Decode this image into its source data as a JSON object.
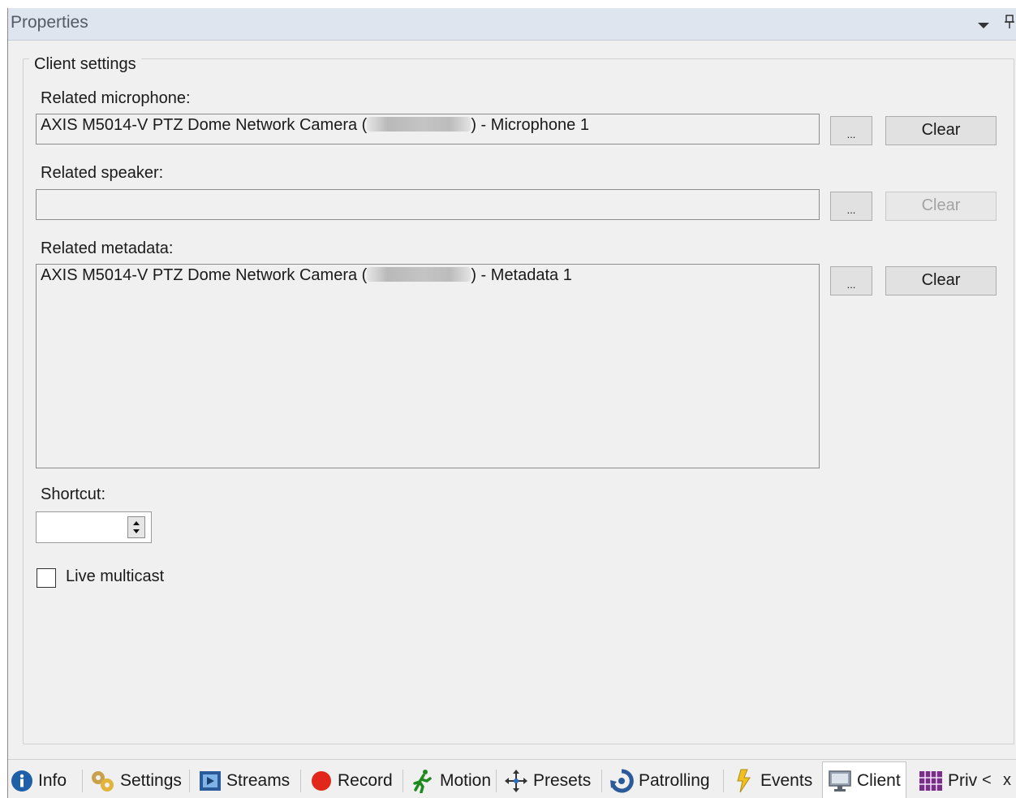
{
  "window": {
    "title": "Properties"
  },
  "group": {
    "title": "Client settings"
  },
  "microphone": {
    "label": "Related microphone:",
    "value_prefix": "AXIS M5014-V PTZ Dome Network Camera (",
    "value_suffix": ") - Microphone 1",
    "browse": "...",
    "clear": "Clear"
  },
  "speaker": {
    "label": "Related speaker:",
    "value": "",
    "browse": "...",
    "clear": "Clear",
    "clear_enabled": false
  },
  "metadata": {
    "label": "Related metadata:",
    "value_prefix": "AXIS M5014-V PTZ Dome Network Camera (",
    "value_suffix": ") - Metadata 1",
    "browse": "...",
    "clear": "Clear"
  },
  "shortcut": {
    "label": "Shortcut:",
    "value": ""
  },
  "live_multicast": {
    "label": "Live multicast",
    "checked": false
  },
  "tabs": [
    {
      "label": "Info",
      "icon": "info-icon"
    },
    {
      "label": "Settings",
      "icon": "settings-icon"
    },
    {
      "label": "Streams",
      "icon": "streams-icon"
    },
    {
      "label": "Record",
      "icon": "record-icon"
    },
    {
      "label": "Motion",
      "icon": "motion-icon"
    },
    {
      "label": "Presets",
      "icon": "presets-icon"
    },
    {
      "label": "Patrolling",
      "icon": "patrolling-icon"
    },
    {
      "label": "Events",
      "icon": "events-icon"
    },
    {
      "label": "Client",
      "icon": "client-icon",
      "active": true
    },
    {
      "label": "Priv",
      "icon": "privacy-mask-icon"
    }
  ],
  "tab_scroll": {
    "left": "<",
    "right": "x"
  }
}
